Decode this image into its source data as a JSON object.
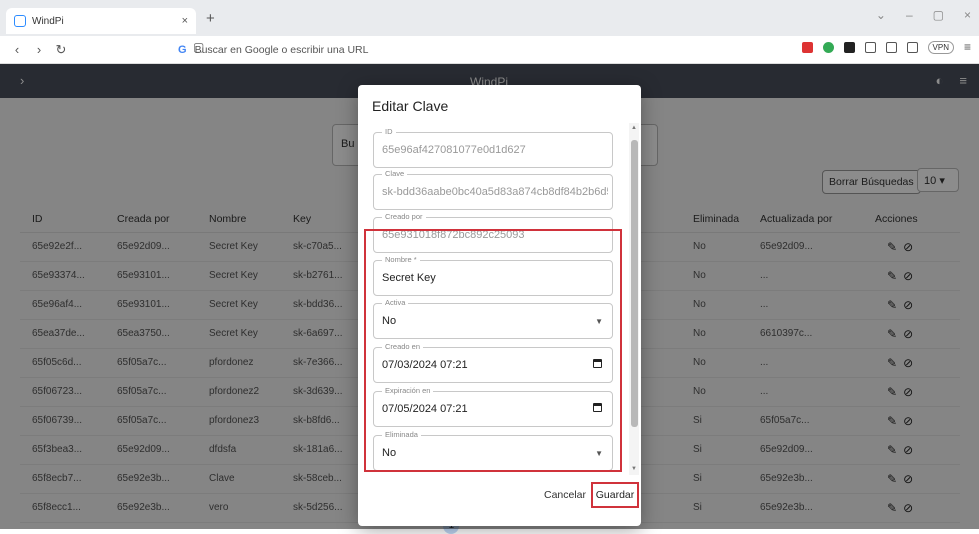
{
  "browser": {
    "tab_title": "WindPi",
    "tab_close": "×",
    "new_tab": "+",
    "url_placeholder": "Buscar en Google o escribir una URL",
    "google_letter": "G",
    "vpn_label": "VPN",
    "window_controls": [
      "⌄",
      "–",
      "▢",
      "×"
    ],
    "nav": [
      "‹",
      "›",
      "↻"
    ]
  },
  "appbar": {
    "menu_icon": "›",
    "brand": "WindPi",
    "right_icons": [
      "◐",
      "≡"
    ]
  },
  "filters": {
    "search_partial": "Bu",
    "clear_button": "Borrar Búsquedas",
    "per_page": "10"
  },
  "table": {
    "headers": [
      "ID",
      "Creada por",
      "Nombre",
      "Key",
      "",
      "",
      "",
      "",
      "Eliminada",
      "Actualizada por",
      "Acciones"
    ],
    "rows": [
      {
        "id": "65e92e2f...",
        "creada": "65e92d09...",
        "nombre": "Secret Key",
        "key": "sk-c70a5...",
        "eliminada": "No",
        "actualizada": "65e92d09..."
      },
      {
        "id": "65e93374...",
        "creada": "65e93101...",
        "nombre": "Secret Key",
        "key": "sk-b2761...",
        "eliminada": "No",
        "actualizada": "..."
      },
      {
        "id": "65e96af4...",
        "creada": "65e93101...",
        "nombre": "Secret Key",
        "key": "sk-bdd36...",
        "eliminada": "No",
        "actualizada": "..."
      },
      {
        "id": "65ea37de...",
        "creada": "65ea3750...",
        "nombre": "Secret Key",
        "key": "sk-6a697...",
        "eliminada": "No",
        "actualizada": "6610397c..."
      },
      {
        "id": "65f05c6d...",
        "creada": "65f05a7c...",
        "nombre": "pfordonez",
        "key": "sk-7e366...",
        "eliminada": "No",
        "actualizada": "..."
      },
      {
        "id": "65f06723...",
        "creada": "65f05a7c...",
        "nombre": "pfordonez2",
        "key": "sk-3d639...",
        "eliminada": "No",
        "actualizada": "..."
      },
      {
        "id": "65f06739...",
        "creada": "65f05a7c...",
        "nombre": "pfordonez3",
        "key": "sk-b8fd6...",
        "eliminada": "Si",
        "actualizada": "65f05a7c..."
      },
      {
        "id": "65f3bea3...",
        "creada": "65e92d09...",
        "nombre": "dfdsfa",
        "key": "sk-181a6...",
        "eliminada": "Si",
        "actualizada": "65e92d09..."
      },
      {
        "id": "65f8ecb7...",
        "creada": "65e92e3b...",
        "nombre": "Clave",
        "key": "sk-58ceb...",
        "eliminada": "Si",
        "actualizada": "65e92e3b..."
      },
      {
        "id": "65f8ecc1...",
        "creada": "65e92e3b...",
        "nombre": "vero",
        "key": "sk-5d256...",
        "eliminada": "Si",
        "actualizada": "65e92e3b..."
      }
    ],
    "action_edit": "✎",
    "action_block": "⊘"
  },
  "pager": [
    "‹",
    "1",
    "2",
    "3",
    "4",
    "›"
  ],
  "dialog": {
    "title": "Editar Clave",
    "fields": {
      "id": {
        "label": "ID",
        "value": "65e96af427081077e0d1d627"
      },
      "clave": {
        "label": "Clave",
        "value": "sk-bdd36aabe0bc40a5d83a874cb8df84b2b6d5ec"
      },
      "creado_por": {
        "label": "Creado por",
        "value": "65e931018f872bc892c25093"
      },
      "nombre": {
        "label": "Nombre *",
        "value": "Secret Key"
      },
      "activa": {
        "label": "Activa",
        "value": "No"
      },
      "creado_en": {
        "label": "Creado en",
        "value": "07/03/2024 07:21"
      },
      "expiracion": {
        "label": "Expiración en",
        "value": "07/05/2024 07:21"
      },
      "eliminada": {
        "label": "Eliminada",
        "value": "No"
      }
    },
    "cancel": "Cancelar",
    "save": "Guardar"
  },
  "colors": {
    "appbar": "#4a4f5c",
    "highlight": "#d0323b"
  }
}
